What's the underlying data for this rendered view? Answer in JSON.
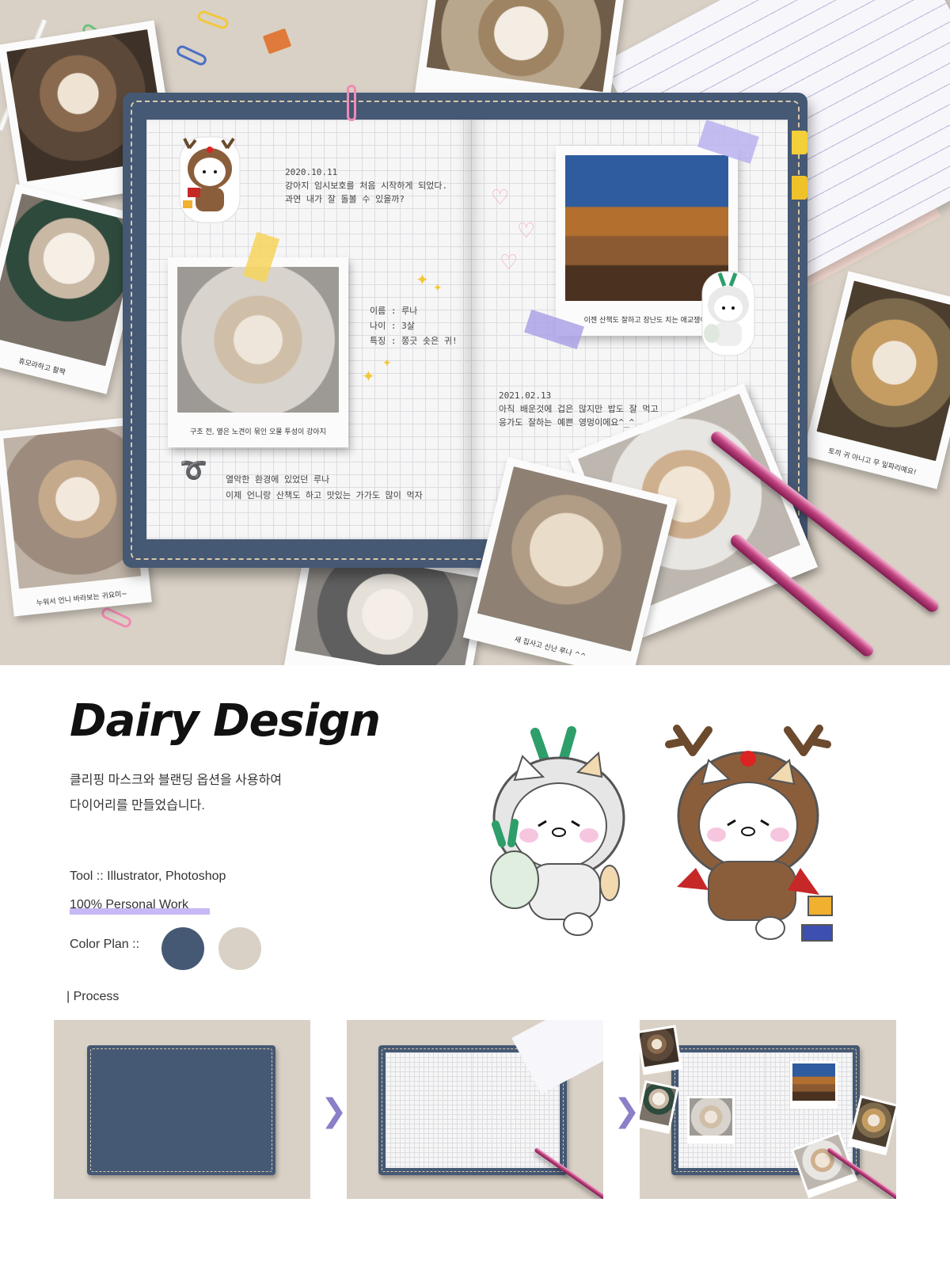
{
  "hero": {
    "diary": {
      "left_page": {
        "entry_date": "2020.10.11",
        "entry_line1": "강아지 임시보호를 처음 시작하게 되었다.",
        "entry_line2": "과연 내가 잘 돌볼 수 있을까?",
        "profile": [
          "이름 : 루나",
          "나이 : 3살",
          "특징 : 쫑긋 솟은 귀!"
        ],
        "photo_caption": "구조 전, 옆은 노견이 묶인 오물 투성이 강아지",
        "bottom_line1": "열악한 환경에 있었던 루나",
        "bottom_line2": "이제 언니랑 산책도 하고 맛있는 가가도 많이 먹자"
      },
      "right_page": {
        "photo_caption": "이젠 산책도 잘하고 장난도 치는 애교쟁이!",
        "entry_date": "2021.02.13",
        "entry_line1": "아직 배운것에 겁은 많지만 밥도 잘 먹고",
        "entry_line2": "응가도 잘하는 예쁜 영멍이에요^_^"
      }
    },
    "polaroids": [
      {
        "caption": ""
      },
      {
        "caption": "휴모라하고 활짝"
      },
      {
        "caption": "누워서 언니 바라보는 귀요미~"
      },
      {
        "caption": ""
      },
      {
        "caption": "토끼 귀 아니고 무 잎파리예요!"
      },
      {
        "caption": "새 집사고 신난 루나 ^^"
      },
      {
        "caption": ""
      }
    ]
  },
  "info": {
    "title": "Dairy Design",
    "desc_line1": "클리핑 마스크와 블랜딩 옵션을 사용하여",
    "desc_line2": "다이어리를 만들었습니다.",
    "tool": "Tool :: Illustrator, Photoshop",
    "personal": "100% Personal Work",
    "color_plan_label": "Color Plan ::",
    "colors": [
      "#455874",
      "#d9d1c6"
    ],
    "process_label": "| Process",
    "arrow_icon": "chevron-right-icon"
  },
  "colors": {
    "accent": "#455874",
    "background": "#d9d1c6",
    "highlight": "#c7b8f6",
    "pen": "#c0437f"
  }
}
